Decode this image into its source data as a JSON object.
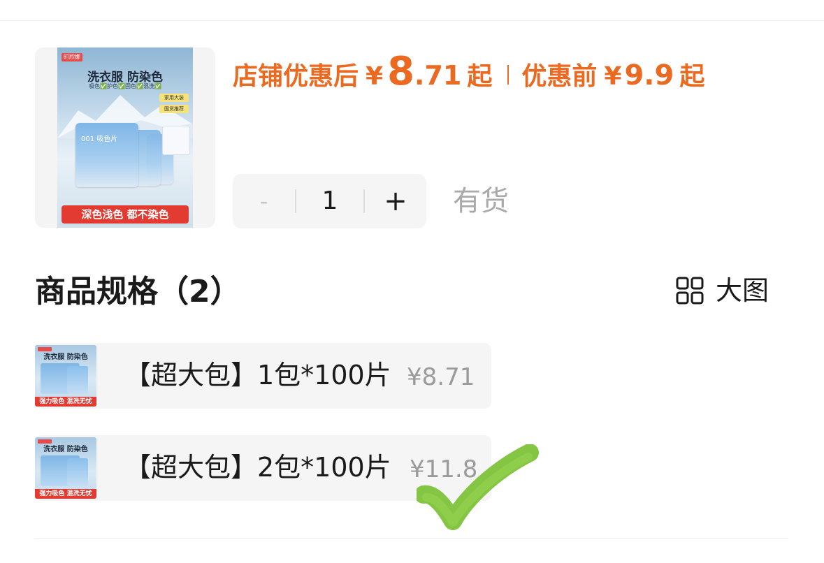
{
  "product": {
    "thumbnail": {
      "brand_tag": "町欣娜",
      "headline": "洗衣服 防染色",
      "features": "吸色✅护色✅固色✅混洗✅",
      "badge_1": "家用大装",
      "badge_2": "国货推荐",
      "pack_label": "001 吸色片",
      "bottom_banner": "深色浅色 都不染色"
    },
    "price_after_discount_label": "店铺优惠后",
    "price_after_yen": "¥",
    "price_after_int": "8",
    "price_after_dec": ".71",
    "price_after_suffix": "起",
    "price_before_label": "优惠前",
    "price_before_yen": "¥",
    "price_before_value": "9.9",
    "price_before_suffix": "起",
    "accent_color": "#ea6a22"
  },
  "quantity": {
    "minus": "-",
    "value": "1",
    "plus": "+",
    "stock_status": "有货"
  },
  "specs": {
    "title": "商品规格（2）",
    "big_image_label": "大图",
    "big_image_icon": "grid-icon",
    "options": [
      {
        "thumb_title": "洗衣服 防染色",
        "thumb_bottom": "强力吸色 混洗无忧",
        "name": "【超大包】1包*100片",
        "price": "¥8.71",
        "selected": false
      },
      {
        "thumb_title": "洗衣服 防染色",
        "thumb_bottom": "强力吸色 混洗无忧",
        "name": "【超大包】2包*100片",
        "price": "¥11.8",
        "selected": true
      }
    ]
  },
  "check_mark": {
    "icon": "check-mark-icon",
    "color": "#7dc23a"
  }
}
